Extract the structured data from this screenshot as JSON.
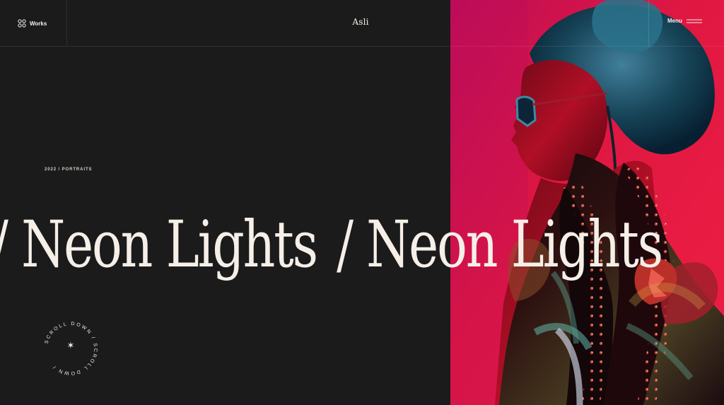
{
  "header": {
    "works_label": "Works",
    "brand": "Asli",
    "menu_label": "Menu"
  },
  "hero": {
    "meta": "2022 / PORTRAITS",
    "title_repeated": [
      "Neon Lights",
      "Neon Lights"
    ],
    "separator": "/"
  },
  "scroll": {
    "label": "SCROLL DOWN / SCROLL DOWN /",
    "center_icon": "✶"
  },
  "icons": {
    "works": "grid-circles-icon",
    "menu": "hamburger-icon",
    "scroll": "asterisk-icon"
  },
  "colors": {
    "background": "#1b1b1b",
    "text": "#f5efe8",
    "photo_accent": "#d6164a"
  }
}
